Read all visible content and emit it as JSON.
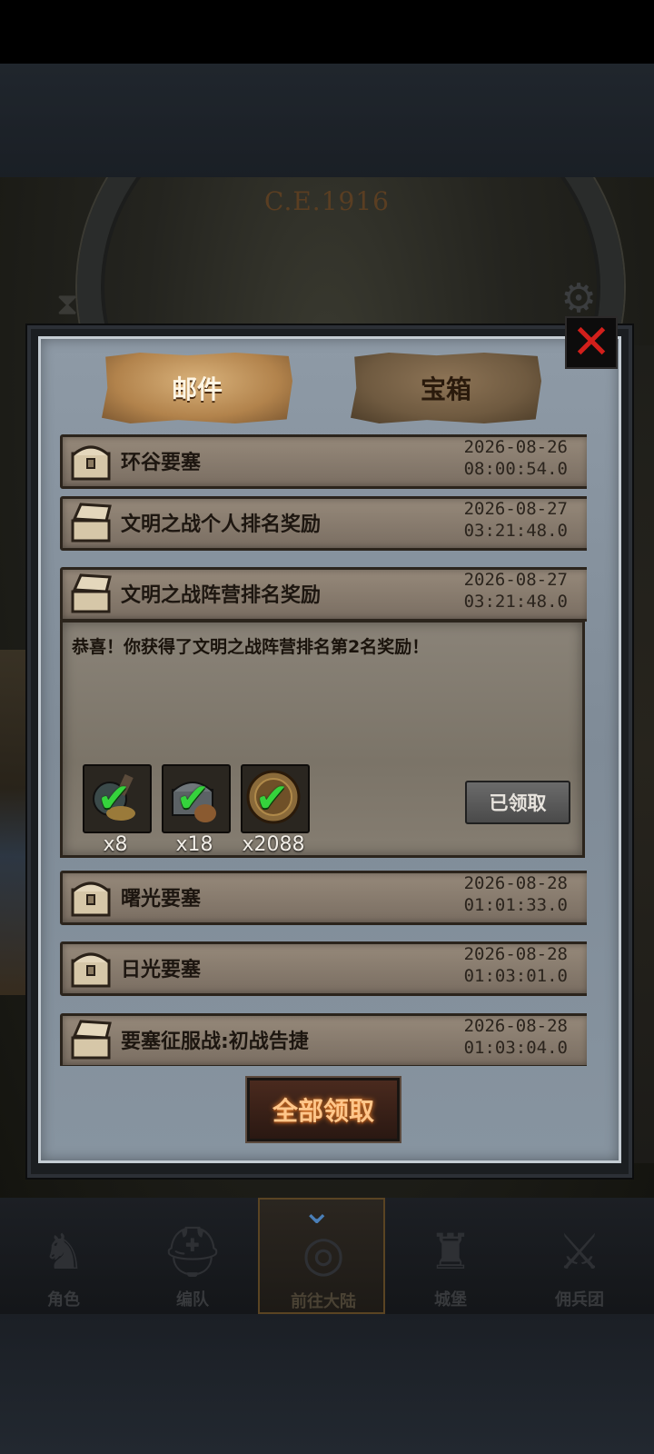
{
  "header": {
    "era_label": "C.E.1916"
  },
  "modal": {
    "tabs": [
      {
        "label": "邮件",
        "active": true
      },
      {
        "label": "宝箱",
        "active": false
      }
    ],
    "mails": [
      {
        "title": "环谷要塞",
        "date": "2026-08-26",
        "time": "08:00:54.0"
      },
      {
        "title": "文明之战个人排名奖励",
        "date": "2026-08-27",
        "time": "03:21:48.0"
      },
      {
        "title": "文明之战阵营排名奖励",
        "date": "2026-08-27",
        "time": "03:21:48.0"
      },
      {
        "title": "曙光要塞",
        "date": "2026-08-28",
        "time": "01:01:33.0"
      },
      {
        "title": "日光要塞",
        "date": "2026-08-28",
        "time": "01:03:01.0"
      },
      {
        "title": "要塞征服战:初战告捷",
        "date": "2026-08-28",
        "time": "01:03:04.0"
      }
    ],
    "expanded": {
      "text": "恭喜！你获得了文明之战阵营排名第2名奖励！",
      "rewards": [
        {
          "icon": "potion-icon",
          "count": "x8"
        },
        {
          "icon": "chest-icon",
          "count": "x18"
        },
        {
          "icon": "coin-icon",
          "count": "x2088"
        }
      ],
      "claimed_label": "已领取"
    },
    "claim_all_label": "全部领取"
  },
  "bottom_nav": {
    "items": [
      {
        "label": "角色",
        "icon": "knight-icon"
      },
      {
        "label": "编队",
        "icon": "helmet-icon"
      },
      {
        "label": "前往大陆",
        "icon": "globe-icon",
        "active": true
      },
      {
        "label": "城堡",
        "icon": "castle-icon"
      },
      {
        "label": "佣兵团",
        "icon": "mercenary-icon"
      }
    ]
  }
}
